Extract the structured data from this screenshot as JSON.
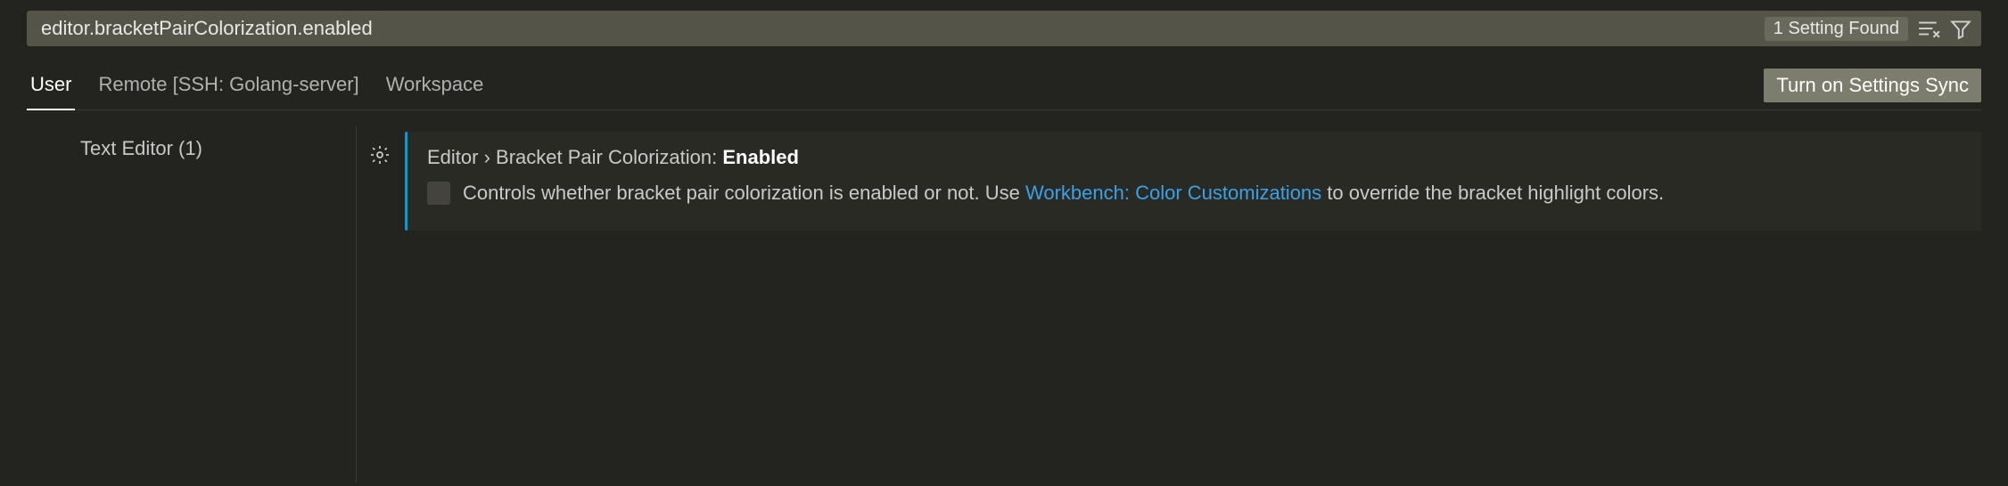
{
  "search": {
    "value": "editor.bracketPairColorization.enabled",
    "found_badge": "1 Setting Found"
  },
  "tabs": {
    "user": "User",
    "remote": "Remote [SSH: Golang-server]",
    "workspace": "Workspace"
  },
  "sync_button": "Turn on Settings Sync",
  "sidebar": {
    "text_editor": "Text Editor (1)"
  },
  "setting": {
    "breadcrumb_prefix": "Editor › Bracket Pair Colorization: ",
    "breadcrumb_strong": "Enabled",
    "desc_before": "Controls whether bracket pair colorization is enabled or not. Use ",
    "desc_link": "Workbench: Color Customizations",
    "desc_after": " to override the bracket highlight colors."
  }
}
